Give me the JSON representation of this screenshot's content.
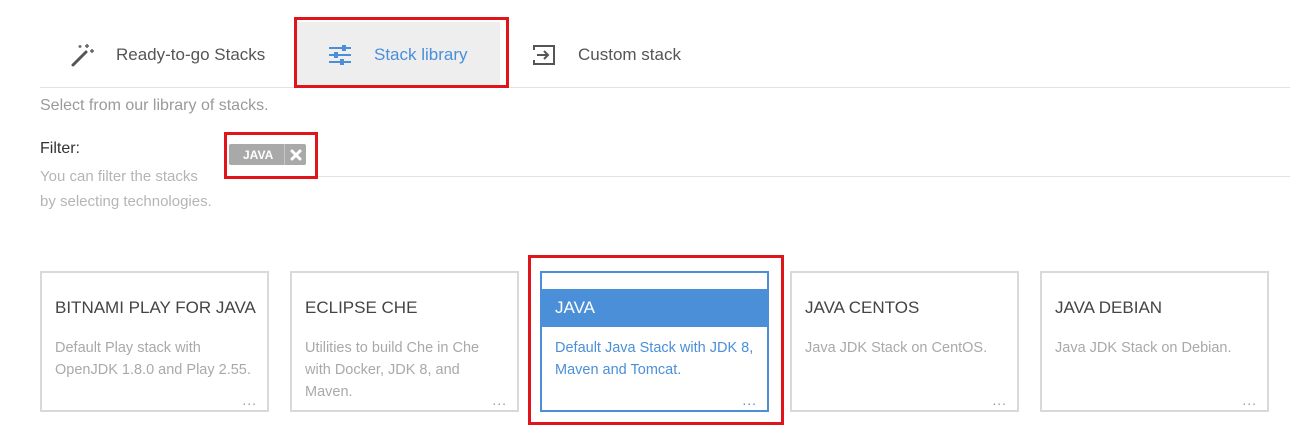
{
  "tabs": [
    {
      "label": "Ready-to-go Stacks",
      "icon": "magic-wand-icon",
      "selected": false
    },
    {
      "label": "Stack library",
      "icon": "sliders-icon",
      "selected": true
    },
    {
      "label": "Custom stack",
      "icon": "import-icon",
      "selected": false
    }
  ],
  "subtitle": "Select from our library of stacks.",
  "filter": {
    "label": "Filter:",
    "help_line1": "You can filter the stacks",
    "help_line2": "by selecting technologies.",
    "tags": [
      {
        "label": "JAVA"
      }
    ]
  },
  "stacks": [
    {
      "title": "BITNAMI PLAY FOR JAVA",
      "description": "Default Play stack with OpenJDK 1.8.0 and Play 2.55.",
      "more": "...",
      "selected": false
    },
    {
      "title": "ECLIPSE CHE",
      "description": "Utilities to build Che in Che with Docker, JDK 8, and Maven.",
      "more": "...",
      "selected": false
    },
    {
      "title": "JAVA",
      "description": "Default Java Stack with JDK 8, Maven and Tomcat.",
      "more": "...",
      "selected": true
    },
    {
      "title": "JAVA CENTOS",
      "description": "Java JDK Stack on CentOS.",
      "more": "...",
      "selected": false
    },
    {
      "title": "JAVA DEBIAN",
      "description": "Java JDK Stack on Debian.",
      "more": "...",
      "selected": false
    }
  ],
  "colors": {
    "accent": "#4a8fd8",
    "highlight": "#e0141b",
    "tab_selected_bg": "#eeeeee",
    "tag_bg": "#a9a9a9"
  }
}
